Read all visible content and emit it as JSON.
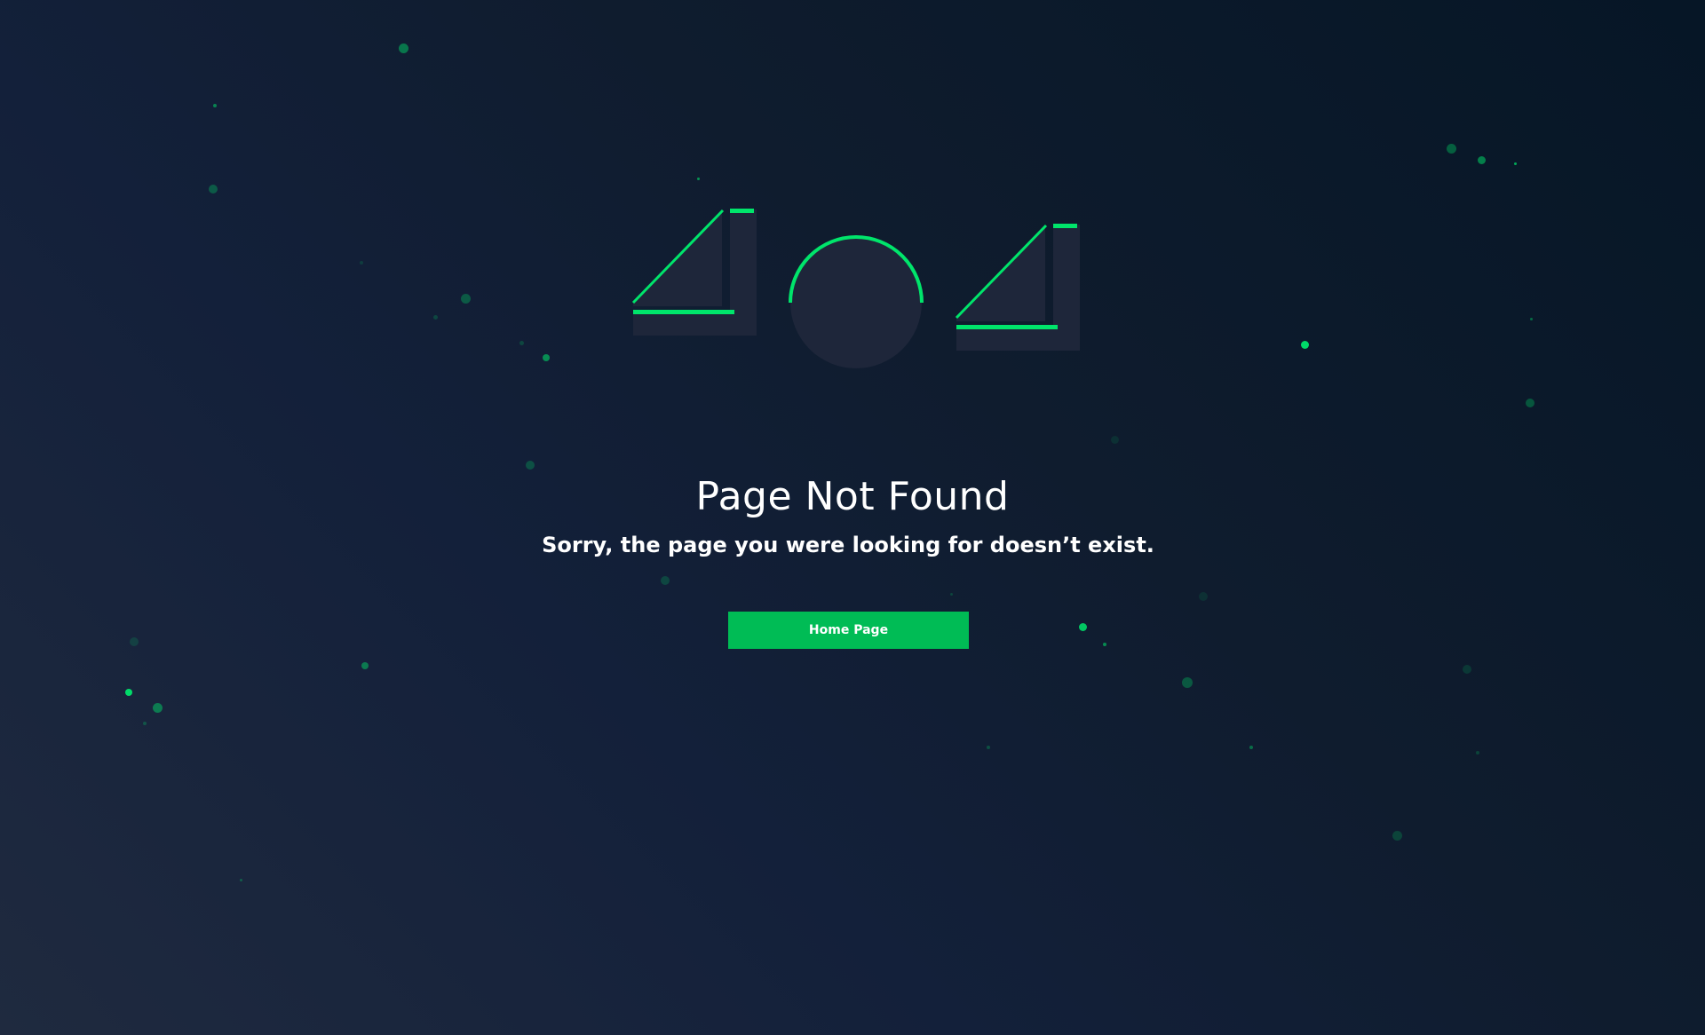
{
  "page": {
    "title": "Page Not Found",
    "subtitle": "Sorry, the page you were looking for doesn’t exist.",
    "home_button_label": "Home Page"
  },
  "illustration": {
    "digits": [
      "4",
      "0",
      "4"
    ],
    "shape_color": "#1e263a",
    "accent_color": "#00e56b"
  },
  "theme": {
    "background_start": "#1f2a3f",
    "background_end": "#061626",
    "button_color": "#00bc55",
    "text_color": "#ffffff"
  }
}
